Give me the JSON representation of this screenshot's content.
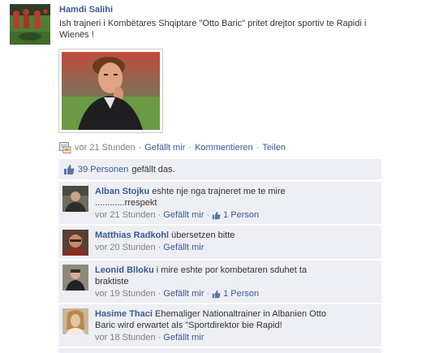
{
  "post": {
    "author": "Hamdi Salihi",
    "text": "Ish trajneri i Kombëtares Shqiptare \"Otto Baric\" pritet drejtor sportiv te Rapidi i Wienës !",
    "time": "vor 21 Stunden",
    "actions": {
      "like": "Gefällt mir",
      "comment": "Kommentieren",
      "share": "Teilen"
    }
  },
  "likes": {
    "count_text": "39 Personen",
    "suffix": "gefällt das."
  },
  "comments": [
    {
      "author": "Alban Stojku",
      "text_line1": "eshte nje nga trajneret me te mire",
      "text_line2": "............rrespekt",
      "time": "vor 21 Stunden",
      "like_label": "Gefällt mir",
      "likes": "1 Person"
    },
    {
      "author": "Matthias Radkohl",
      "text_line1": "übersetzen bitte",
      "text_line2": "",
      "time": "vor 20 Stunden",
      "like_label": "Gefällt mir",
      "likes": ""
    },
    {
      "author": "Leonid Blloku",
      "text_line1": "i mire eshte por kombetaren sduhet ta",
      "text_line2": "braktiste",
      "time": "vor 19 Stunden",
      "like_label": "Gefällt mir",
      "likes": "1 Person"
    },
    {
      "author": "Hasime Thaci",
      "text_line1": "Ehemaliger Nationaltrainer in Albanien Otto",
      "text_line2": "Baric wird erwartet als \"Sportdirektor bie Rapid!",
      "time": "vor 18 Stunden",
      "like_label": "Gefällt mir",
      "likes": ""
    }
  ],
  "colors": {
    "link": "#3b5998",
    "ufi_bg": "#edeff4",
    "meta_grey": "#808080"
  },
  "icons": {
    "meta": "post-type-icon",
    "thumb": "thumbs-up-icon"
  }
}
